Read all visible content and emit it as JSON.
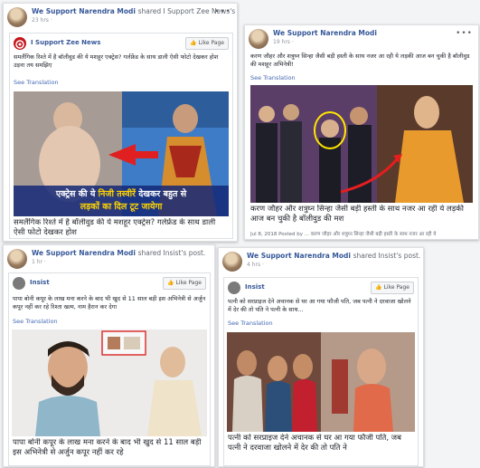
{
  "post1": {
    "sharer": "We Support Narendra Modi",
    "action": "shared I Support Zee News's post.",
    "time": "23 hrs ·",
    "dots": "•••",
    "page": "I Support Zee News",
    "like_label": "Like Page",
    "text": "समलैंगिक रिश्ते में है बॉलीवुड की ये मशहूर एक्ट्रेस? गर्लफ्रेंड के साथ डाली ऐसी फोटो देखकर होश उड़ना तय समझिए",
    "see_translation": "See Translation",
    "overlay_line1_a": "एक्ट्रेस की ये ",
    "overlay_line1_b": "निजी तस्वीरें",
    "overlay_line1_c": " देखकर बहुत से",
    "overlay_line2": "लड़कों का दिल टूट जायेगा",
    "caption": "समलैंगिक रिश्ते में है बॉलीवुड की ये मशहूर एक्ट्रेस? गर्लफ्रेंड के साथ डाली ऐसी फोटो देखकर होश"
  },
  "post2": {
    "sharer": "We Support Narendra Modi",
    "time": "19 hrs ·",
    "dots": "•••",
    "text": "करण जौहर और शत्रुघ्न सिन्हा जैसी बड़ी हस्ती के साथ नजर आ रही ये लड़की आज बन चुकी है बॉलीवुड की मशहूर अभिनेत्री!",
    "see_translation": "See Translation",
    "caption": "करण जौहर और शत्रुघ्न सिन्हा जैसी बड़ी हस्ती के साथ नजर आ रही ये लड़की आज बन चुकी है बॉलीवुड की मश",
    "sub": "Jul 8, 2018 Posted by ... करण जौहर और शत्रुघ्न सिन्हा जैसी बड़ी हस्ती के साथ नजर आ रही ये"
  },
  "post3": {
    "sharer": "We Support Narendra Modi",
    "action": "shared Insist's post.",
    "time": "1 hr ·",
    "dots": "•••",
    "page": "Insist",
    "like_label": "Like Page",
    "text": "पापा बोनी कपूर के लाख मना करने के बाद भी खुद से 11 साल बड़ी इस अभिनेत्री से अर्जुन कपूर नहीं कर रहे रिश्ता खत्म, नाम हैरान कर देगा",
    "see_translation": "See Translation",
    "caption": "पापा बोनी कपूर के लाख मना करने के बाद भी खुद से 11 साल बड़ी इस अभिनेत्री से अर्जुन कपूर नहीं कर रहे"
  },
  "post4": {
    "sharer": "We Support Narendra Modi",
    "action": "shared Insist's post.",
    "time": "4 hrs ·",
    "dots": "•••",
    "page": "Insist",
    "like_label": "Like Page",
    "text": "पत्नी को सरप्राइज देने अचानक से घर आ गया फौजी पति, जब पत्नी ने दरवाजा खोलने में देर की तो पति ने पत्नी के साथ...",
    "see_translation": "See Translation",
    "caption": "पत्नी को सरप्राइज देने अचानक से घर आ गया फौजी पति, जब पत्नी ने दरवाजा खोलने में देर की तो पति ने"
  }
}
